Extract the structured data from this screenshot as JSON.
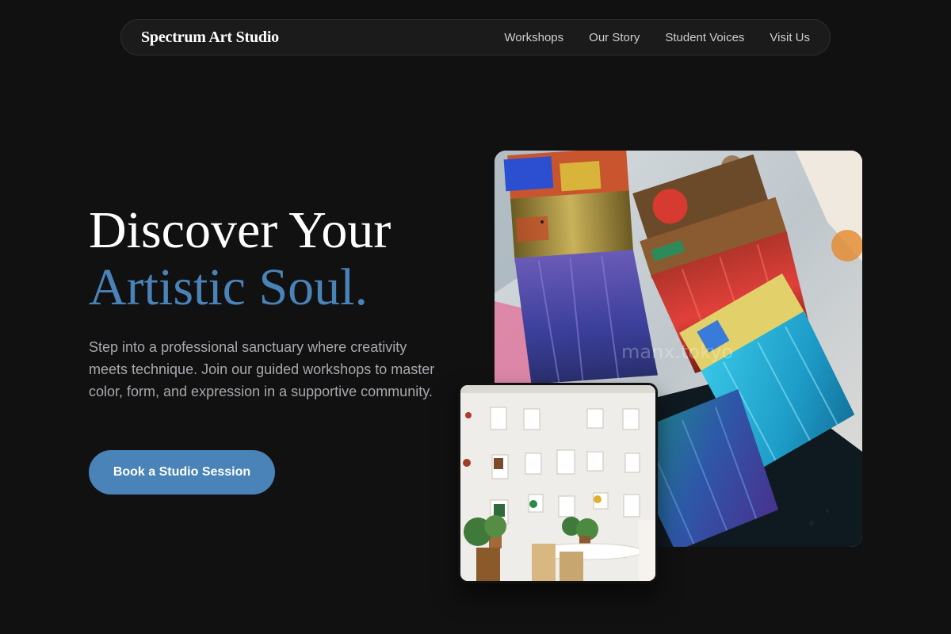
{
  "nav": {
    "brand": "Spectrum Art Studio",
    "links": [
      "Workshops",
      "Our Story",
      "Student Voices",
      "Visit Us"
    ]
  },
  "hero": {
    "title_line1": "Discover Your",
    "title_line2": "Artistic Soul.",
    "description": "Step into a professional sanctuary where creativity meets technique. Join our guided workshops to master color, form, and expression in a supportive community.",
    "cta_label": "Book a Studio Session"
  },
  "images": {
    "main": {
      "alt": "paint-brushes-photo",
      "watermark": "manx.tokyo"
    },
    "secondary": {
      "alt": "studio-wall-photo"
    }
  },
  "colors": {
    "background": "#111112",
    "accent": "#4a83b8",
    "text_muted": "#a8a8ad"
  }
}
